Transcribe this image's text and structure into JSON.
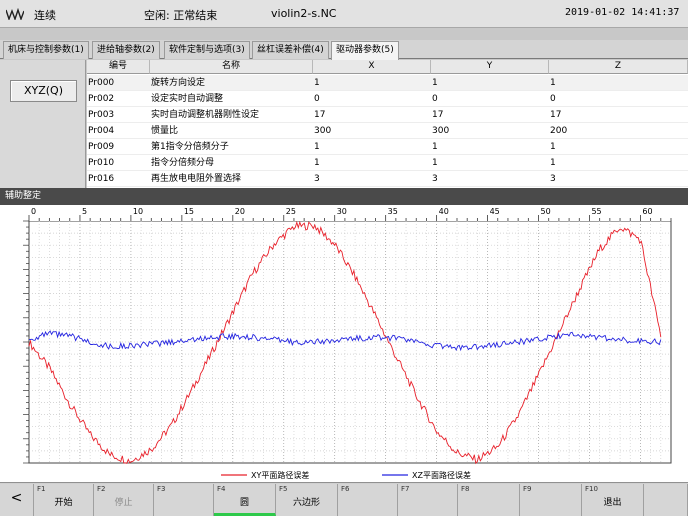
{
  "titlebar": {
    "logo_icon": "waveform-icon",
    "mode": "连续",
    "status": "空闲: 正常结束",
    "program": "violin2-s.NC",
    "datetime": "2019-01-02 14:41:37"
  },
  "tabs": [
    {
      "label": "机床与控制参数(1)",
      "active": false
    },
    {
      "label": "进给轴参数(2)",
      "active": false
    },
    {
      "label": "软件定制与选项(3)",
      "active": false
    },
    {
      "label": "丝杠误差补偿(4)",
      "active": false
    },
    {
      "label": "驱动器参数(5)",
      "active": true
    }
  ],
  "left_panel": {
    "axis_button": "XYZ(Q)"
  },
  "param_table": {
    "headers": [
      "编号",
      "名称",
      "X",
      "Y",
      "Z"
    ],
    "rows": [
      [
        "Pr000",
        "旋转方向设定",
        "1",
        "1",
        "1"
      ],
      [
        "Pr002",
        "设定实时自动调整",
        "0",
        "0",
        "0"
      ],
      [
        "Pr003",
        "实时自动调整机器刚性设定",
        "17",
        "17",
        "17"
      ],
      [
        "Pr004",
        "惯量比",
        "300",
        "300",
        "200"
      ],
      [
        "Pr009",
        "第1指令分倍频分子",
        "1",
        "1",
        "1"
      ],
      [
        "Pr010",
        "指令分倍频分母",
        "1",
        "1",
        "1"
      ],
      [
        "Pr016",
        "再生放电电阻外置选择",
        "3",
        "3",
        "3"
      ]
    ]
  },
  "chart_section": {
    "title": "辅助整定"
  },
  "chart_data": {
    "type": "line",
    "xlim": [
      0,
      63
    ],
    "x_ticks": [
      0,
      5,
      10,
      15,
      20,
      25,
      30,
      35,
      40,
      45,
      50,
      55,
      60
    ],
    "grid": true,
    "legend_placement": "bottom",
    "series": [
      {
        "name": "XY平面路径误差",
        "color": "#e8202a",
        "x": [
          0,
          2,
          4,
          6,
          8,
          10,
          12,
          14,
          16,
          18,
          20,
          22,
          24,
          26,
          28,
          30,
          32,
          34,
          36,
          38,
          40,
          42,
          44,
          46,
          48,
          50,
          52,
          54,
          56,
          58,
          60,
          62
        ],
        "y": [
          0,
          -0.22,
          -0.52,
          -0.78,
          -0.95,
          -1.0,
          -0.9,
          -0.7,
          -0.4,
          -0.08,
          0.25,
          0.58,
          0.82,
          0.97,
          0.98,
          0.82,
          0.55,
          0.22,
          -0.12,
          -0.45,
          -0.75,
          -0.93,
          -0.99,
          -0.88,
          -0.62,
          -0.28,
          0.08,
          0.44,
          0.78,
          0.97,
          0.86,
          0.05
        ]
      },
      {
        "name": "XZ平面路径误差",
        "color": "#2424e0",
        "x": [
          0,
          2,
          4,
          6,
          8,
          10,
          12,
          14,
          16,
          18,
          20,
          22,
          24,
          26,
          28,
          30,
          32,
          34,
          36,
          38,
          40,
          42,
          44,
          46,
          48,
          50,
          52,
          54,
          56,
          58,
          60,
          62
        ],
        "y": [
          0.02,
          0.07,
          0.05,
          0.0,
          -0.04,
          -0.03,
          -0.02,
          0.0,
          0.02,
          0.04,
          0.05,
          0.04,
          0.02,
          0.0,
          0.0,
          0.01,
          0.03,
          0.04,
          0.03,
          0.0,
          -0.03,
          -0.05,
          -0.04,
          -0.02,
          0.0,
          0.02,
          0.05,
          0.06,
          0.04,
          0.02,
          0.01,
          0.0
        ]
      }
    ]
  },
  "function_keys": [
    {
      "num": "",
      "label": "<",
      "icon": "back-arrow-icon",
      "disabled": false,
      "active": false
    },
    {
      "num": "F1",
      "label": "开始",
      "disabled": false,
      "active": false
    },
    {
      "num": "F2",
      "label": "停止",
      "disabled": true,
      "active": false
    },
    {
      "num": "F3",
      "label": "",
      "disabled": false,
      "active": false
    },
    {
      "num": "F4",
      "label": "圆",
      "disabled": false,
      "active": true
    },
    {
      "num": "F5",
      "label": "六边形",
      "disabled": false,
      "active": false
    },
    {
      "num": "F6",
      "label": "",
      "disabled": false,
      "active": false
    },
    {
      "num": "F7",
      "label": "",
      "disabled": false,
      "active": false
    },
    {
      "num": "F8",
      "label": "",
      "disabled": false,
      "active": false
    },
    {
      "num": "F9",
      "label": "",
      "disabled": false,
      "active": false
    },
    {
      "num": "F10",
      "label": "退出",
      "disabled": false,
      "active": false
    },
    {
      "num": "",
      "label": "",
      "disabled": false,
      "active": false
    }
  ]
}
